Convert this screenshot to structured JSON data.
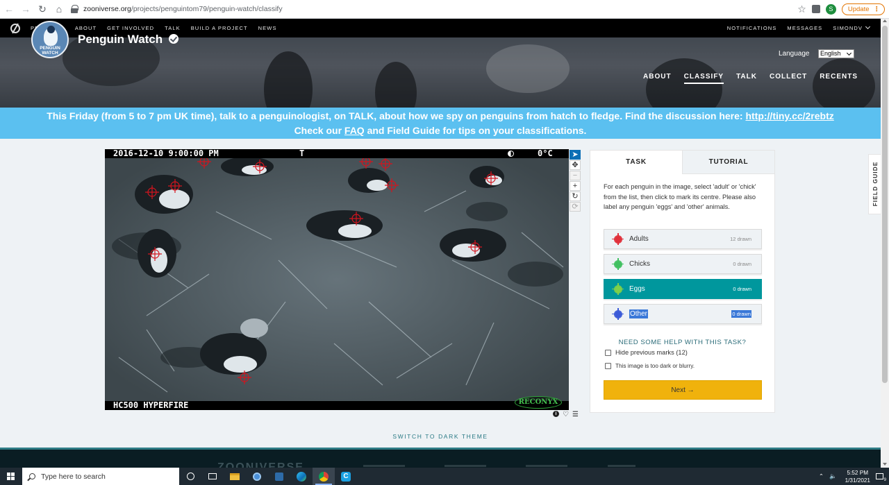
{
  "browser": {
    "url_domain": "zooniverse.org",
    "url_path": "/projects/penguintom79/penguin-watch/classify",
    "update_label": "Update",
    "profile_initial": "S"
  },
  "zoo_nav": {
    "left": [
      "PROJECTS",
      "ABOUT",
      "GET INVOLVED",
      "TALK",
      "BUILD A PROJECT",
      "NEWS"
    ],
    "right": [
      "NOTIFICATIONS",
      "MESSAGES",
      "SIMONDV"
    ]
  },
  "project": {
    "avatar_text_1": "PENGUIN",
    "avatar_text_2": "WATCH",
    "title": "Penguin Watch",
    "language_label": "Language",
    "language_value": "English",
    "nav": [
      "ABOUT",
      "CLASSIFY",
      "TALK",
      "COLLECT",
      "RECENTS"
    ],
    "active_nav": "CLASSIFY"
  },
  "announcement": {
    "line1": "This Friday (from 5 to 7 pm UK time), talk to a penguinologist, on TALK, about how we spy on penguins from hatch to fledge. Find the discussion here: ",
    "link": "http://tiny.cc/2rebtz",
    "line2_pre": "Check our ",
    "faq": "FAQ",
    "line2_post": " and Field Guide for tips on your classifications."
  },
  "subject": {
    "timestamp": "2016-12-10  9:00:00 PM",
    "t_marker": "T",
    "temperature": "0°C",
    "camera_model": "HC500 HYPERFIRE",
    "brand": "RECONYX",
    "mark_color": "#d4141e"
  },
  "toolbar": {
    "tools": [
      "pointer-icon",
      "move-icon",
      "zoom-out-icon",
      "zoom-in-icon",
      "rotate-icon",
      "reset-icon"
    ]
  },
  "task": {
    "tabs": [
      "TASK",
      "TUTORIAL"
    ],
    "instructions": "For each penguin in the image, select 'adult' or 'chick' from the list, then click to mark its centre. Please also label any penguin 'eggs' and 'other' animals.",
    "choices": [
      {
        "label": "Adults",
        "count": "12 drawn",
        "color": "#e0303a"
      },
      {
        "label": "Chicks",
        "count": "0 drawn",
        "color": "#40c060"
      },
      {
        "label": "Eggs",
        "count": "0 drawn",
        "color": "#7ed04a"
      },
      {
        "label": "Other",
        "count": "0 drawn",
        "color": "#3a5ad8"
      }
    ],
    "help": "NEED SOME HELP WITH THIS TASK?",
    "hide_marks": "Hide previous marks (12)",
    "too_dark": "This image is too dark or blurry.",
    "next": "Next →"
  },
  "field_guide": "FIELD GUIDE",
  "dark_theme": "SWITCH TO DARK THEME",
  "footer_logo": "ZOONIVERSE",
  "taskbar": {
    "search_placeholder": "Type here to search",
    "time": "5:52 PM",
    "date": "1/31/2021",
    "notif_count": "9"
  }
}
